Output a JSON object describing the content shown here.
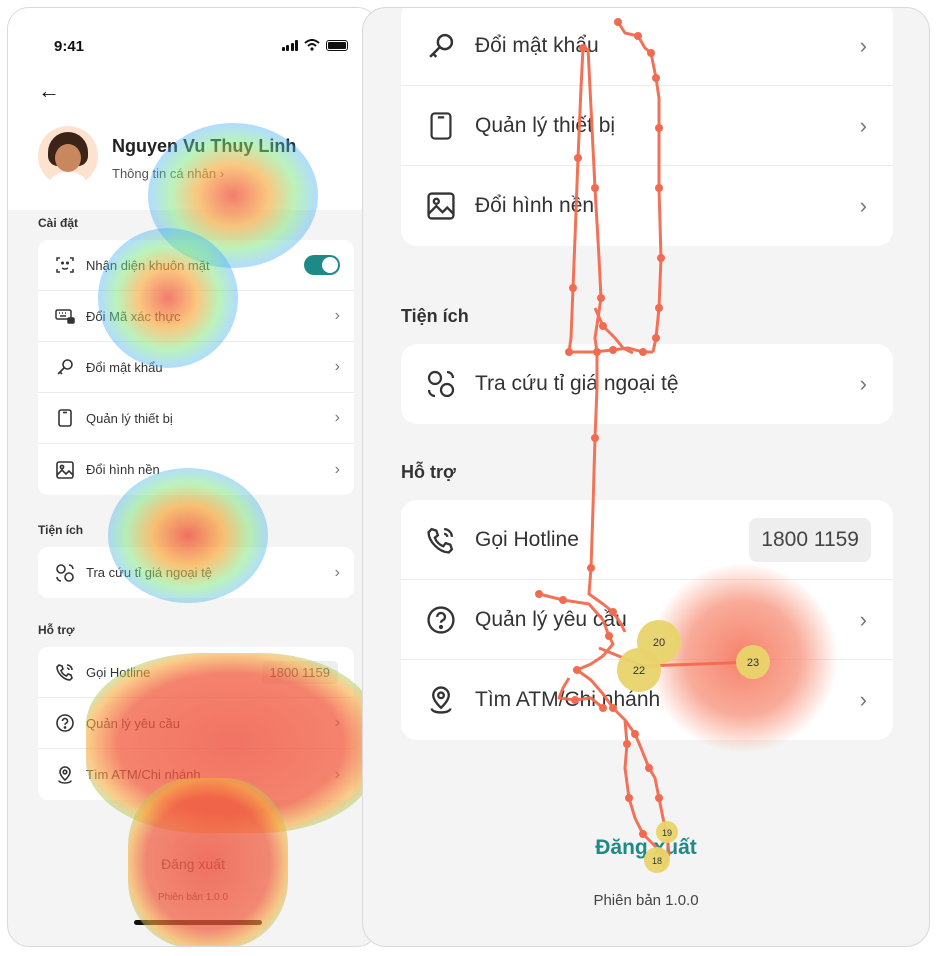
{
  "left": {
    "status": {
      "time": "9:41"
    },
    "profile": {
      "name": "Nguyen Vu Thuy Linh",
      "subtitle": "Thông tin cá nhân  ›"
    },
    "sections": {
      "settings": "Cài đặt",
      "utilities": "Tiện ích",
      "support": "Hỗ trợ"
    },
    "settings_items": [
      {
        "label": "Nhận diện khuôn mặt",
        "icon": "face-id-icon",
        "control": "toggle-on"
      },
      {
        "label": "Đổi Mã xác thực",
        "icon": "keyboard-lock-icon"
      },
      {
        "label": "Đổi mật khẩu",
        "icon": "key-icon"
      },
      {
        "label": "Quản lý thiết bị",
        "icon": "phone-device-icon"
      },
      {
        "label": "Đổi hình nền",
        "icon": "image-icon"
      }
    ],
    "utility_items": [
      {
        "label": "Tra cứu tỉ giá ngoại tệ",
        "icon": "currency-exchange-icon"
      }
    ],
    "support_items": [
      {
        "label": "Gọi Hotline",
        "icon": "phone-call-icon",
        "value": "1800 1159"
      },
      {
        "label": "Quản lý yêu cầu",
        "icon": "question-icon"
      },
      {
        "label": "Tìm ATM/Chi nhánh",
        "icon": "location-pin-icon"
      }
    ],
    "logout": "Đăng xuất",
    "version": "Phiên bản 1.0.0"
  },
  "right": {
    "settings_items": [
      {
        "label": "Đổi mật khẩu",
        "icon": "key-icon"
      },
      {
        "label": "Quản lý thiết bị",
        "icon": "phone-device-icon"
      },
      {
        "label": "Đổi hình nền",
        "icon": "image-icon"
      }
    ],
    "sections": {
      "utilities": "Tiện ích",
      "support": "Hỗ trợ"
    },
    "utility_items": [
      {
        "label": "Tra cứu tỉ giá ngoại tệ",
        "icon": "currency-exchange-icon"
      }
    ],
    "support_items": [
      {
        "label": "Gọi Hotline",
        "icon": "phone-call-icon",
        "value": "1800 1159"
      },
      {
        "label": "Quản lý yêu cầu",
        "icon": "question-icon"
      },
      {
        "label": "Tìm ATM/Chi nhánh",
        "icon": "location-pin-icon"
      }
    ],
    "logout": "Đăng xuất",
    "version": "Phiên bản 1.0.0",
    "fixation_labels": [
      "20",
      "22",
      "23",
      "19",
      "18"
    ]
  },
  "colors": {
    "accent": "#1e8a86",
    "gaze_path": "#f26b50",
    "fixation": "#e8d46a"
  }
}
